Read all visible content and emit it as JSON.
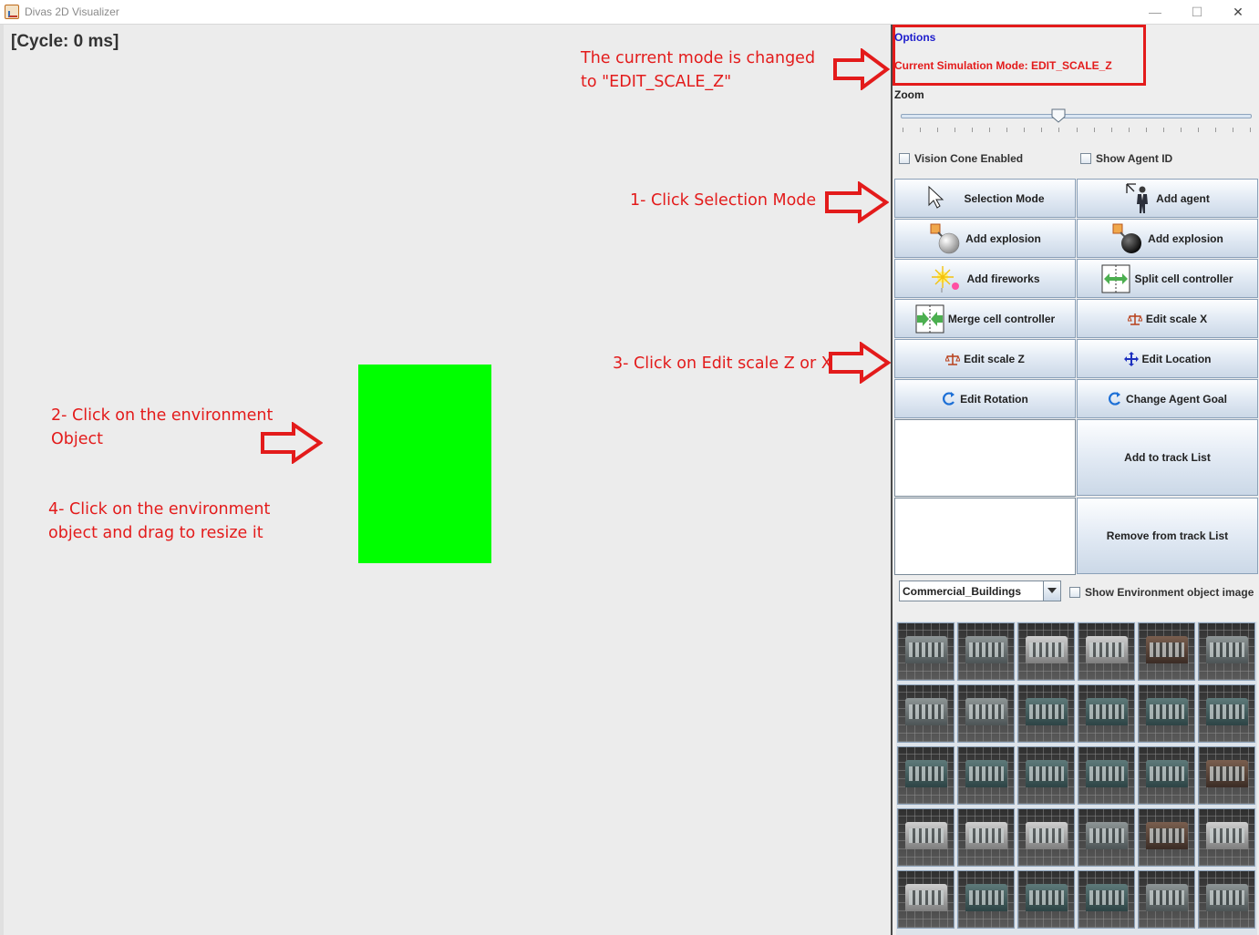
{
  "window": {
    "title": "Divas 2D Visualizer",
    "minimize": "—",
    "maximize": "☐",
    "close": "✕"
  },
  "canvas": {
    "cycle": "[Cycle: 0 ms]",
    "object_color": "#00ff00"
  },
  "annotations": {
    "mode_changed": "The current mode is changed\nto \"EDIT_SCALE_Z\"",
    "step1": "1- Click Selection Mode",
    "step2": "2- Click on the environment\nObject",
    "step3": "3- Click on Edit scale Z or X",
    "step4": "4- Click on the environment\nobject and drag to resize it",
    "color": "#e31b1b"
  },
  "panel": {
    "options_label": "Options",
    "mode_label": "Current Simulation Mode: EDIT_SCALE_Z",
    "zoom_label": "Zoom",
    "zoom_value": 0.45,
    "checkboxes": {
      "vision_cone": "Vision Cone Enabled",
      "show_agent_id": "Show Agent ID",
      "show_env_image": "Show Environment object image"
    },
    "buttons": {
      "selection_mode": "Selection Mode",
      "add_agent": "Add agent",
      "add_explosion_1": "Add explosion",
      "add_explosion_2": "Add explosion",
      "add_fireworks": "Add fireworks",
      "split_cell": "Split cell controller",
      "merge_cell": "Merge cell controller",
      "edit_scale_x": "Edit scale X",
      "edit_scale_z": "Edit scale Z",
      "edit_location": "Edit Location",
      "edit_rotation": "Edit Rotation",
      "change_agent_goal": "Change Agent Goal",
      "add_track": "Add to track List",
      "remove_track": "Remove from track List"
    },
    "category_select": "Commercial_Buildings"
  },
  "thumbnails_icon": "building-thumbnail"
}
